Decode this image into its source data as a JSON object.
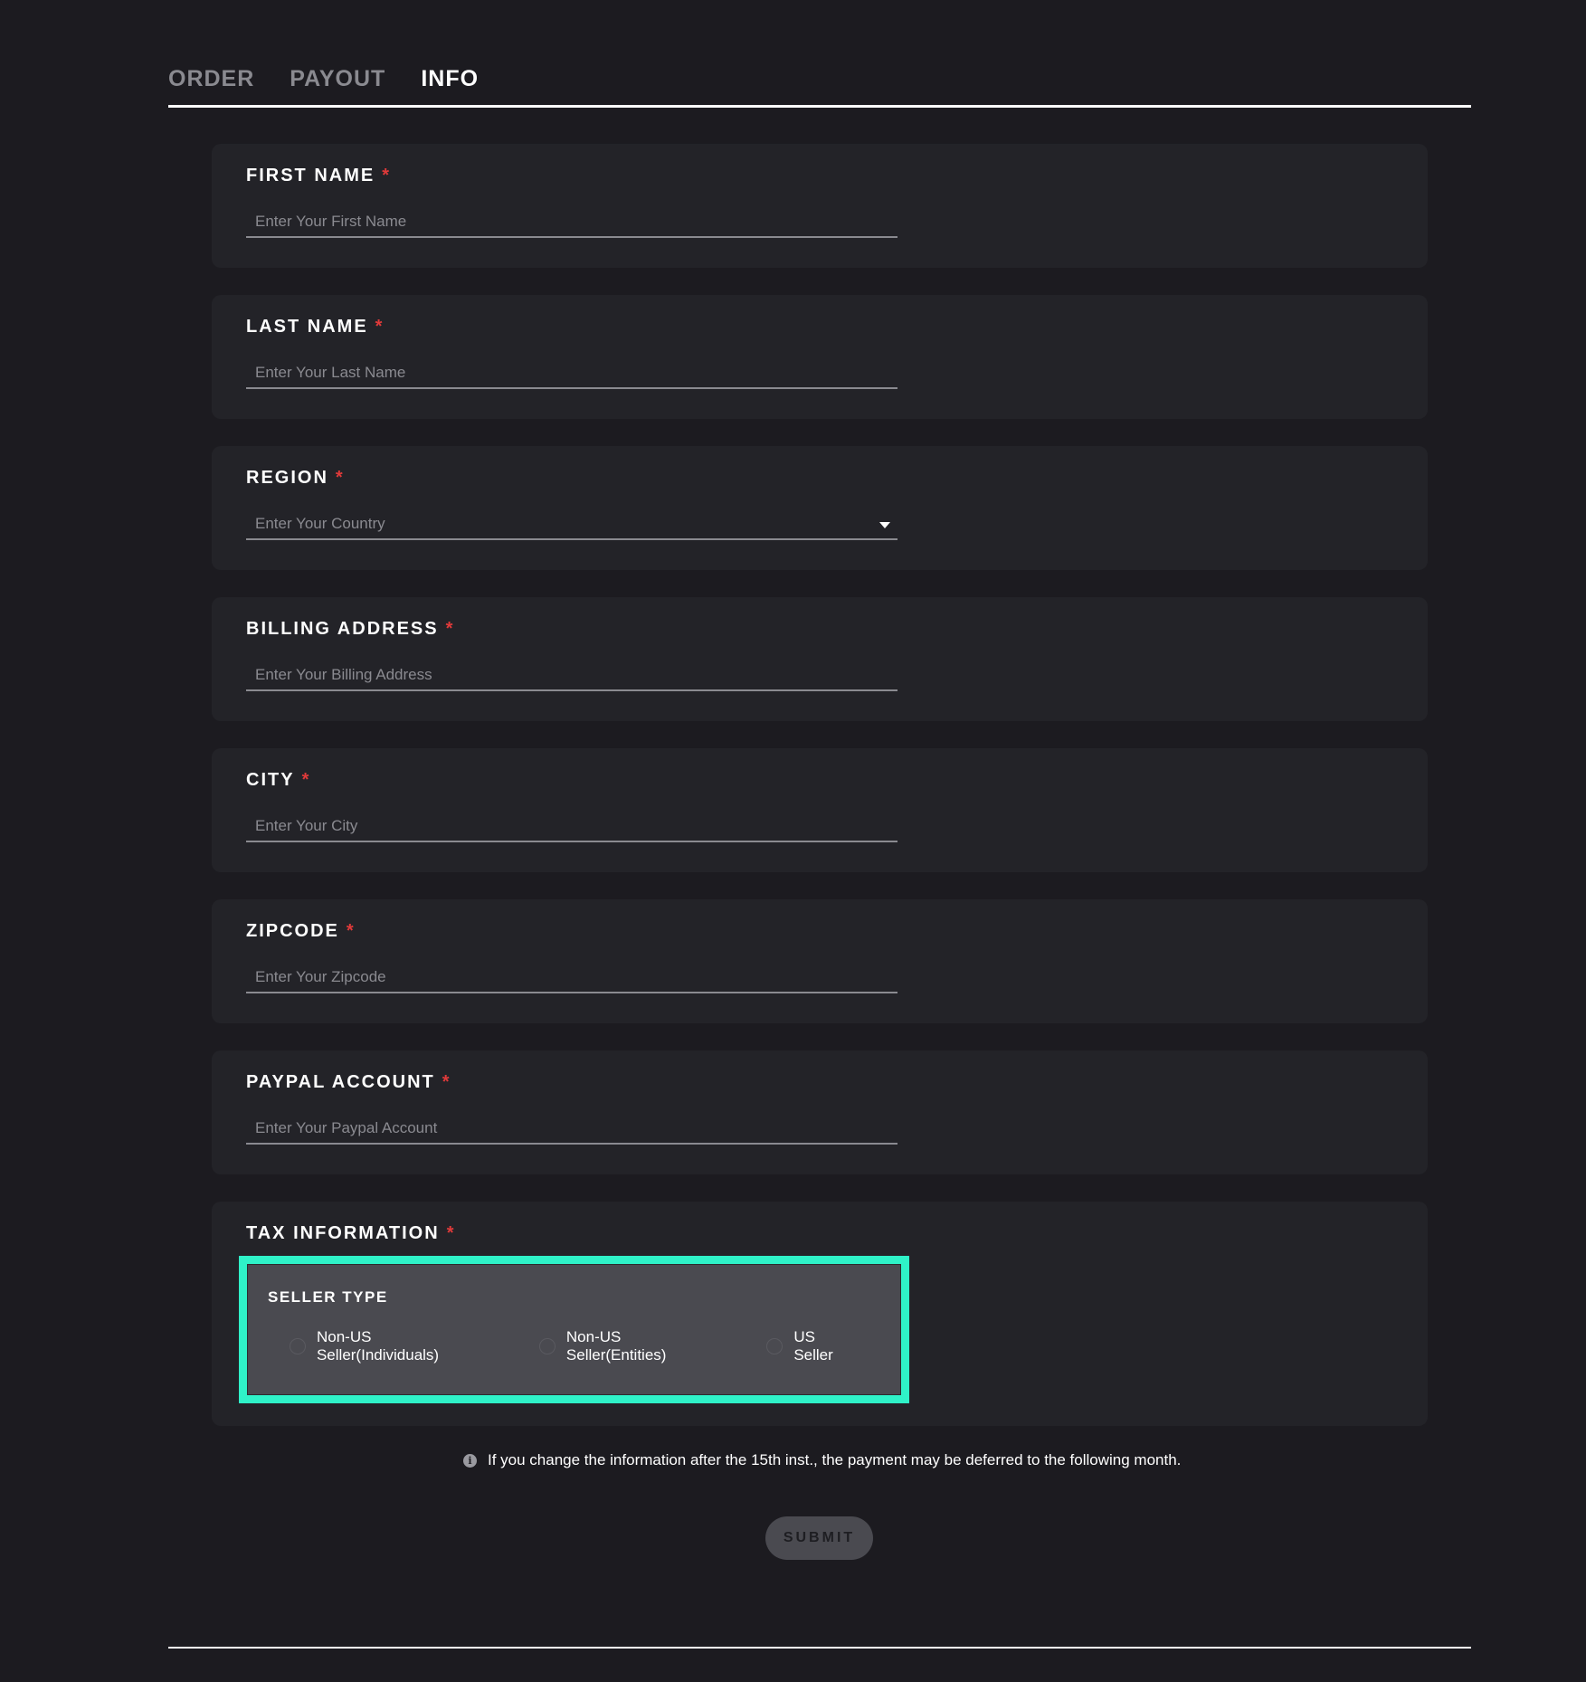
{
  "tabs": [
    {
      "label": "ORDER"
    },
    {
      "label": "PAYOUT"
    },
    {
      "label": "INFO"
    }
  ],
  "form": {
    "required_mark": "*",
    "first_name": {
      "label": "FIRST NAME",
      "placeholder": "Enter Your First Name"
    },
    "last_name": {
      "label": "LAST NAME",
      "placeholder": "Enter Your Last Name"
    },
    "region": {
      "label": "REGION",
      "placeholder": "Enter Your Country"
    },
    "billing_address": {
      "label": "BILLING ADDRESS",
      "placeholder": "Enter Your Billing Address"
    },
    "city": {
      "label": "CITY",
      "placeholder": "Enter Your City"
    },
    "zipcode": {
      "label": "ZIPCODE",
      "placeholder": "Enter Your Zipcode"
    },
    "paypal_account": {
      "label": "PAYPAL ACCOUNT",
      "placeholder": "Enter Your Paypal Account"
    },
    "tax_information": {
      "label": "TAX INFORMATION",
      "seller_type": {
        "title": "SELLER TYPE",
        "options": [
          {
            "label": "Non-US Seller(Individuals)"
          },
          {
            "label": "Non-US Seller(Entities)"
          },
          {
            "label": "US Seller"
          }
        ]
      }
    }
  },
  "notice": {
    "icon": "info-icon",
    "text": "If you change the information after the 15th inst., the payment may be deferred to the following month."
  },
  "submit_label": "SUBMIT",
  "colors": {
    "highlight": "#2ff2c8",
    "required": "#e03a3a",
    "background": "#1c1b20",
    "card": "#232328"
  }
}
